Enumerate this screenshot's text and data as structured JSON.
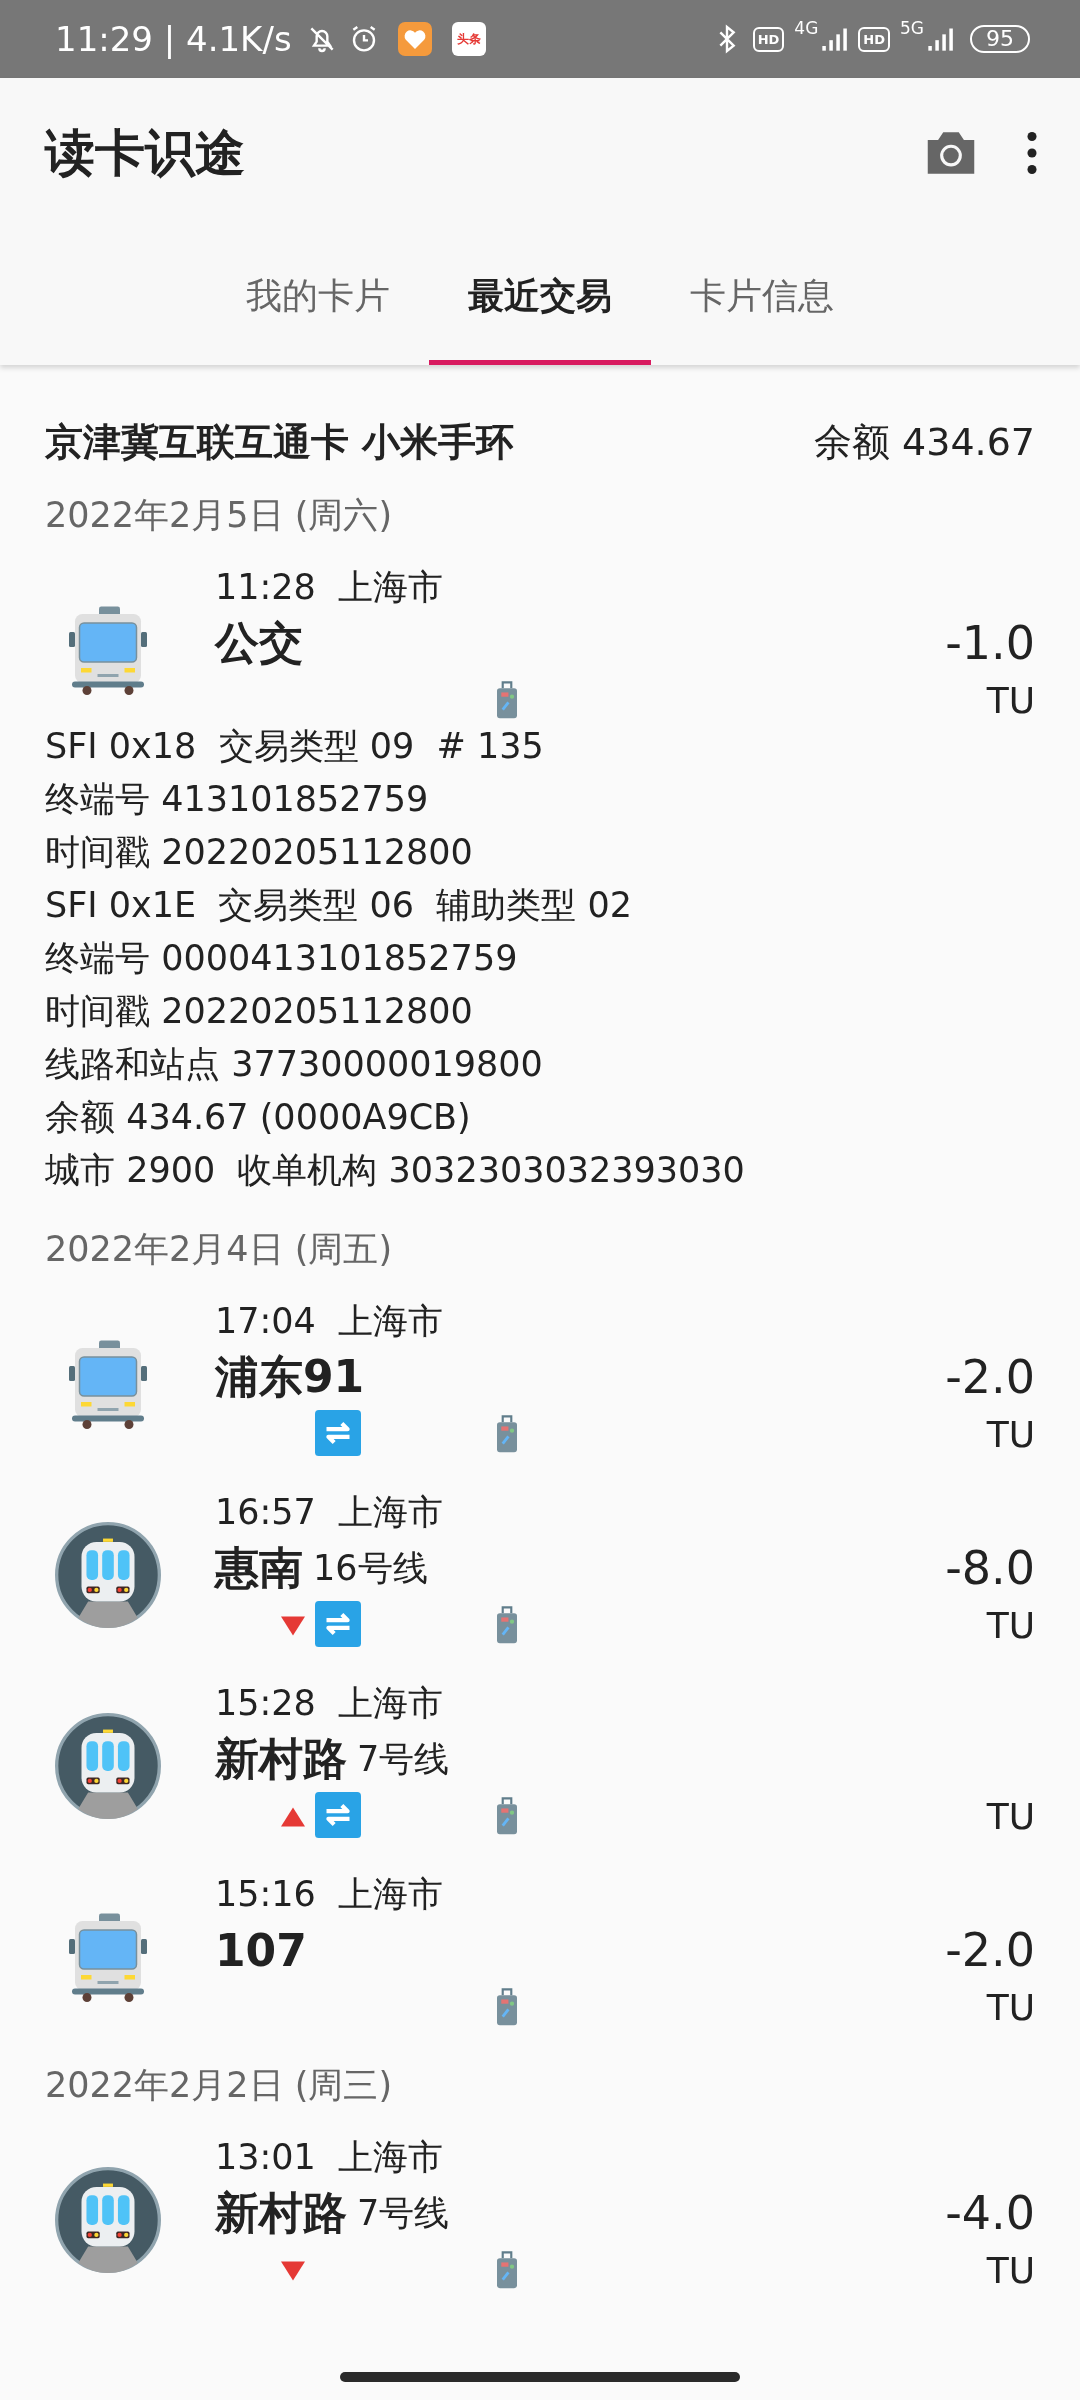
{
  "status_bar": {
    "time": "11:29 | 4.1K/s",
    "app_badge": "头条",
    "network_1": "4G",
    "network_2": "5G",
    "hd_1": "HD",
    "hd_2": "HD",
    "battery": "95"
  },
  "app_bar": {
    "title": "读卡识途"
  },
  "tabs": [
    {
      "label": "我的卡片",
      "selected": false
    },
    {
      "label": "最近交易",
      "selected": true
    },
    {
      "label": "卡片信息",
      "selected": false
    }
  ],
  "card": {
    "name": "京津冀互联互通卡 小米手环",
    "balance": "余额 434.67"
  },
  "days": [
    {
      "date": "2022年2月5日 (周六)",
      "transactions": [
        {
          "kind": "bus",
          "time": "11:28",
          "city": "上海市",
          "station": "公交",
          "amount": "-1.0",
          "unit": "TU",
          "entry": false,
          "exit": false,
          "transfer": false,
          "details": [
            "SFI 0x18  交易类型 09  # 135",
            "终端号 413101852759",
            "时间戳 20220205112800",
            "SFI 0x1E  交易类型 06  辅助类型 02",
            "终端号 0000413101852759",
            "时间戳 20220205112800",
            "线路和站点 37730000019800",
            "余额 434.67 (0000A9CB)",
            "城市 2900  收单机构 3032303032393030"
          ]
        }
      ]
    },
    {
      "date": "2022年2月4日 (周五)",
      "transactions": [
        {
          "kind": "bus",
          "time": "17:04",
          "city": "上海市",
          "station": "浦东91",
          "amount": "-2.0",
          "unit": "TU",
          "entry": false,
          "exit": false,
          "transfer": true
        },
        {
          "kind": "metro",
          "time": "16:57",
          "city": "上海市",
          "station": "惠南",
          "line": "16号线",
          "amount": "-8.0",
          "unit": "TU",
          "entry": false,
          "exit": true,
          "transfer": true
        },
        {
          "kind": "metro",
          "time": "15:28",
          "city": "上海市",
          "station": "新村路",
          "line": "7号线",
          "unit": "TU",
          "entry": true,
          "exit": false,
          "transfer": true
        },
        {
          "kind": "bus",
          "time": "15:16",
          "city": "上海市",
          "station": "107",
          "amount": "-2.0",
          "unit": "TU",
          "entry": false,
          "exit": false,
          "transfer": false
        }
      ]
    },
    {
      "date": "2022年2月2日 (周三)",
      "transactions": [
        {
          "kind": "metro",
          "time": "13:01",
          "city": "上海市",
          "station": "新村路",
          "line": "7号线",
          "amount": "-4.0",
          "unit": "TU",
          "entry": false,
          "exit": true,
          "transfer": false
        }
      ]
    }
  ]
}
